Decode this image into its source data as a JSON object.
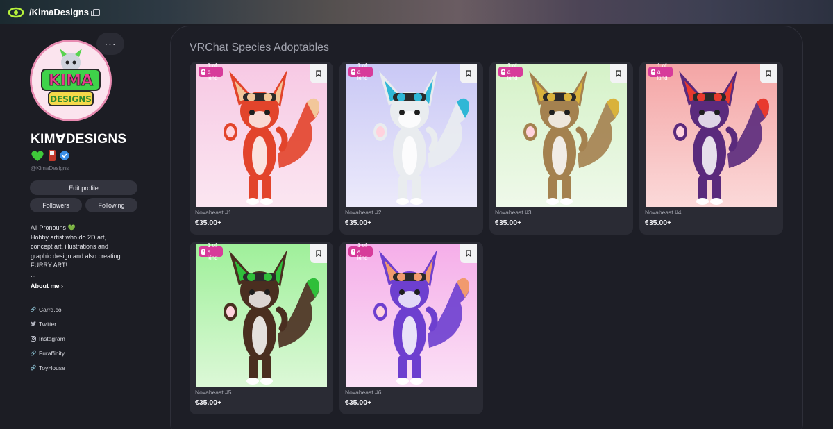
{
  "topbar": {
    "title": "/KimaDesigns",
    "logo_icon": "eye-logo-icon",
    "copy_icon": "copy-icon"
  },
  "profile": {
    "avatar_text_top": "KIMA",
    "avatar_text_bottom": "DESIGNS",
    "more_label": "···",
    "name": "KIMⱯDESIGNS",
    "badges": [
      "green-heart-icon",
      "phone-icon",
      "verified-icon"
    ],
    "handle": "@KimaDesigns",
    "edit_label": "Edit profile",
    "followers_label": "Followers",
    "following_label": "Following",
    "bio_lines": [
      "All Pronouns 💚",
      "Hobby artist who do 2D art,",
      "concept art, illustrations and",
      "graphic design and also creating",
      "FURRY ART!",
      "..."
    ],
    "about_label": "About me ›",
    "links": [
      {
        "icon": "link-icon",
        "label": "Carrd.co"
      },
      {
        "icon": "twitter-icon",
        "label": "Twitter"
      },
      {
        "icon": "instagram-icon",
        "label": "Instagram"
      },
      {
        "icon": "link-icon",
        "label": "Furaffinity"
      },
      {
        "icon": "link-icon",
        "label": "ToyHouse"
      }
    ]
  },
  "section": {
    "title": "VRChat Species Adoptables"
  },
  "cards": [
    {
      "tag": "1 of a kind",
      "name": "Novabeast #1",
      "price": "€35.00+",
      "bg_top": "#f7c9e4",
      "bg_bottom": "#fbe6f1",
      "fur": "#e2442b",
      "accent": "#f2c79a"
    },
    {
      "tag": "1 of a kind",
      "name": "Novabeast #2",
      "price": "€35.00+",
      "bg_top": "#c9c8f5",
      "bg_bottom": "#eceafb",
      "fur": "#e9ecef",
      "accent": "#2fb7d6"
    },
    {
      "tag": "1 of a kind",
      "name": "Novabeast #3",
      "price": "€35.00+",
      "bg_top": "#d5f2c8",
      "bg_bottom": "#eff9ea",
      "fur": "#a4814f",
      "accent": "#d9b23b"
    },
    {
      "tag": "1 of a kind",
      "name": "Novabeast #4",
      "price": "€35.00+",
      "bg_top": "#f4a5a5",
      "bg_bottom": "#fbd9d9",
      "fur": "#5a2a7c",
      "accent": "#e8392e"
    },
    {
      "tag": "1 of a kind",
      "name": "Novabeast #5",
      "price": "€35.00+",
      "bg_top": "#9ff09a",
      "bg_bottom": "#dcf8d7",
      "fur": "#4a2e20",
      "accent": "#2fbf3a"
    },
    {
      "tag": "1 of a kind",
      "name": "Novabeast #6",
      "price": "€35.00+",
      "bg_top": "#f5aee9",
      "bg_bottom": "#fbe1f6",
      "fur": "#6d3fcf",
      "accent": "#f19a6e"
    }
  ]
}
